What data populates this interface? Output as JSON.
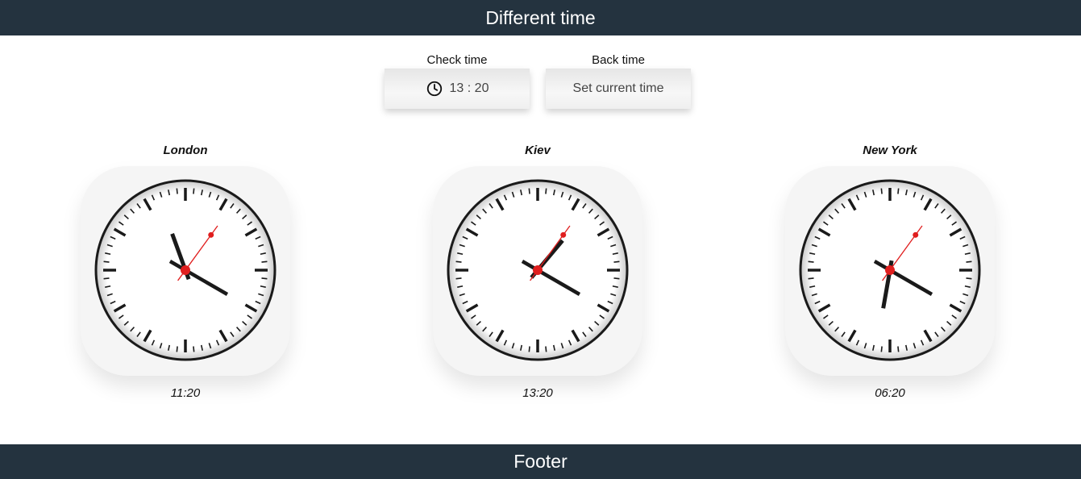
{
  "header": {
    "title": "Different time"
  },
  "controls": {
    "check_label": "Check time",
    "check_value": "13 : 20",
    "back_label": "Back time",
    "back_button": "Set current time"
  },
  "clocks": [
    {
      "city": "London",
      "time": "11:20",
      "hour": 11,
      "minute": 20,
      "second": 6
    },
    {
      "city": "Kiev",
      "time": "13:20",
      "hour": 13,
      "minute": 20,
      "second": 6
    },
    {
      "city": "New York",
      "time": "06:20",
      "hour": 6,
      "minute": 20,
      "second": 6
    }
  ],
  "footer": {
    "title": "Footer"
  },
  "colors": {
    "bar": "#24333f",
    "second_hand": "#e01e1e",
    "hand": "#1a1a1a"
  }
}
